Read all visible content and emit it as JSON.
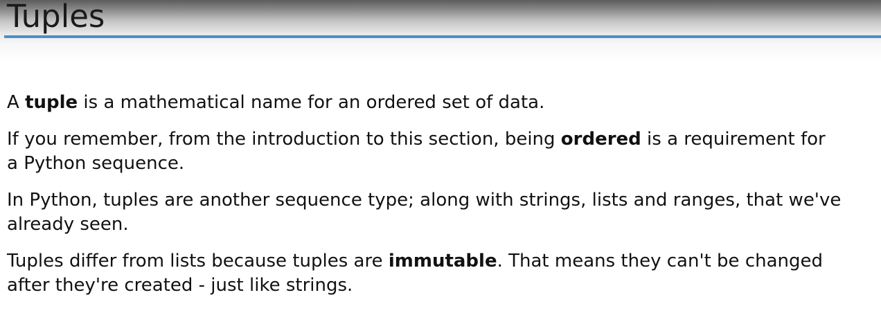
{
  "slide": {
    "title": "Tuples"
  },
  "paragraphs": [
    {
      "lines": [
        [
          {
            "text": "A ",
            "bold": false
          },
          {
            "text": "tuple",
            "bold": true
          },
          {
            "text": " is a mathematical name for an ordered set of data.",
            "bold": false
          }
        ]
      ]
    },
    {
      "lines": [
        [
          {
            "text": "If you remember, from the introduction to this section, being ",
            "bold": false
          },
          {
            "text": "ordered",
            "bold": true
          },
          {
            "text": " is a requirement for",
            "bold": false
          }
        ],
        [
          {
            "text": "a Python sequence.",
            "bold": false
          }
        ]
      ]
    },
    {
      "lines": [
        [
          {
            "text": "In Python, tuples are another sequence type; along with strings, lists and ranges, that we've",
            "bold": false
          }
        ],
        [
          {
            "text": "already seen.",
            "bold": false
          }
        ]
      ]
    },
    {
      "lines": [
        [
          {
            "text": "Tuples differ from lists because tuples are ",
            "bold": false
          },
          {
            "text": "immutable",
            "bold": true
          },
          {
            "text": ". That means they can't be changed",
            "bold": false
          }
        ],
        [
          {
            "text": "after they're created - just like strings.",
            "bold": false
          }
        ]
      ]
    }
  ]
}
